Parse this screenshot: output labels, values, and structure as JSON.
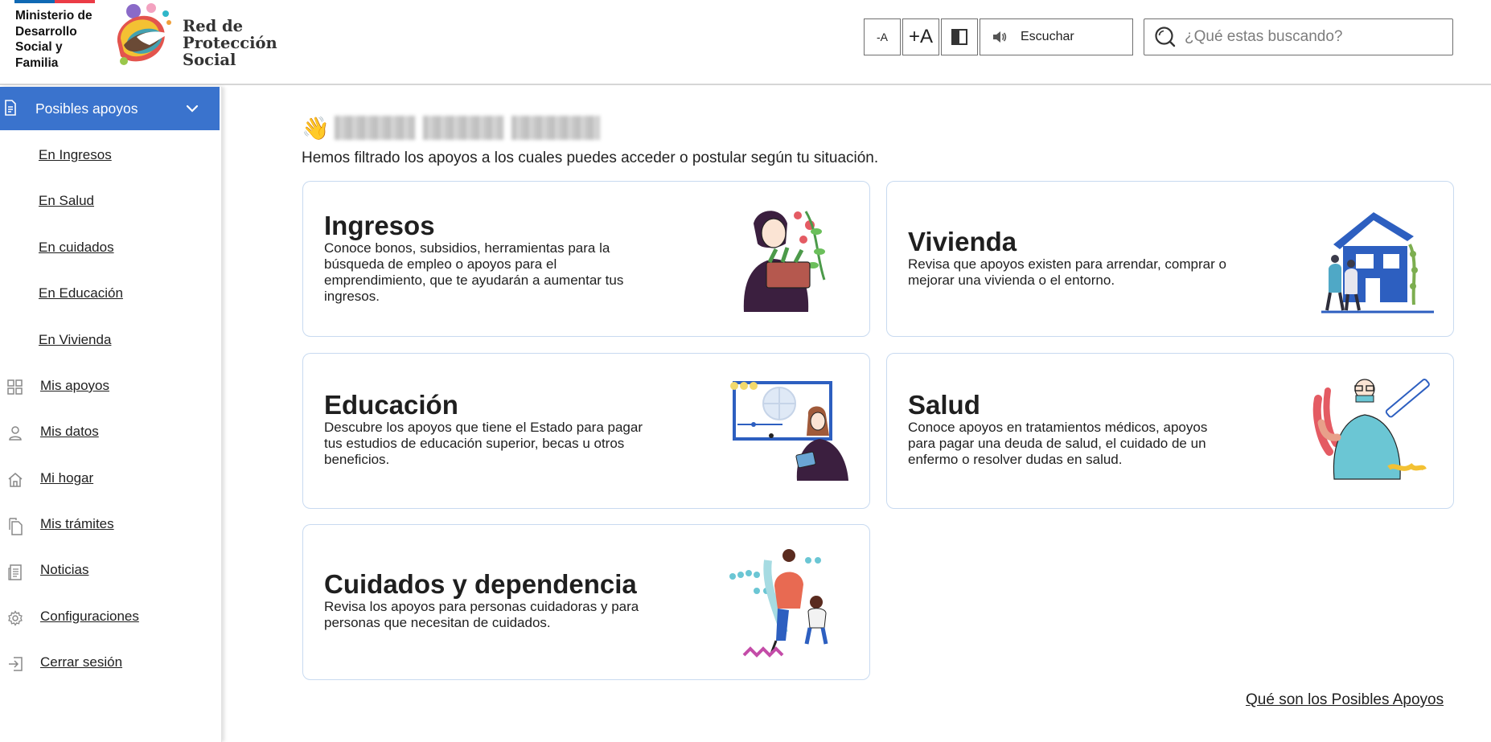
{
  "header": {
    "ministry_name": "Ministerio de Desarrollo Social y Familia",
    "brand_name": "Red de Protección Social",
    "brand_line1": "Red de",
    "brand_line2": "Protección",
    "brand_line3": "Social",
    "font_decrease_label": "-A",
    "font_increase_label": "+A",
    "listen_label": "Escuchar",
    "search_placeholder": "¿Qué estas buscando?",
    "ministry_colors": [
      "#0f69b4",
      "#eb3c46"
    ]
  },
  "sidebar": {
    "active_section": "Posibles apoyos",
    "sub_items": [
      "En Ingresos",
      "En Salud",
      "En cuidados",
      "En Educación",
      "En Vivienda"
    ],
    "items": [
      {
        "label": "Mis apoyos",
        "icon": "grid-icon"
      },
      {
        "label": "Mis datos",
        "icon": "user-icon"
      },
      {
        "label": "Mi hogar",
        "icon": "home-icon"
      },
      {
        "label": "Mis trámites",
        "icon": "documents-icon"
      },
      {
        "label": "Noticias",
        "icon": "newspaper-icon"
      },
      {
        "label": "Configuraciones",
        "icon": "gear-icon"
      },
      {
        "label": "Cerrar sesión",
        "icon": "logout-icon"
      }
    ],
    "accent_color": "#3a73cd"
  },
  "main": {
    "greeting_emoji": "👋",
    "intro": "Hemos filtrado los apoyos a los cuales puedes acceder o postular según tu situación.",
    "cards": [
      {
        "title": "Ingresos",
        "description": "Conoce bonos, subsidios, herramientas para la búsqueda de empleo o apoyos para el emprendimiento, que te ayudarán a aumentar tus ingresos."
      },
      {
        "title": "Vivienda",
        "description": "Revisa que apoyos existen para arrendar, comprar o mejorar una vivienda o el entorno."
      },
      {
        "title": "Educación",
        "description": "Descubre los apoyos que tiene el Estado para pagar tus estudios de educación superior, becas u otros beneficios."
      },
      {
        "title": "Salud",
        "description": "Conoce apoyos en tratamientos médicos, apoyos para pagar una deuda de salud, el cuidado de un enfermo o resolver dudas en salud."
      },
      {
        "title": "Cuidados y dependencia",
        "description": "Revisa los apoyos para personas cuidadoras y para personas que necesitan de cuidados."
      }
    ],
    "footer_link": "Qué son los Posibles Apoyos"
  }
}
